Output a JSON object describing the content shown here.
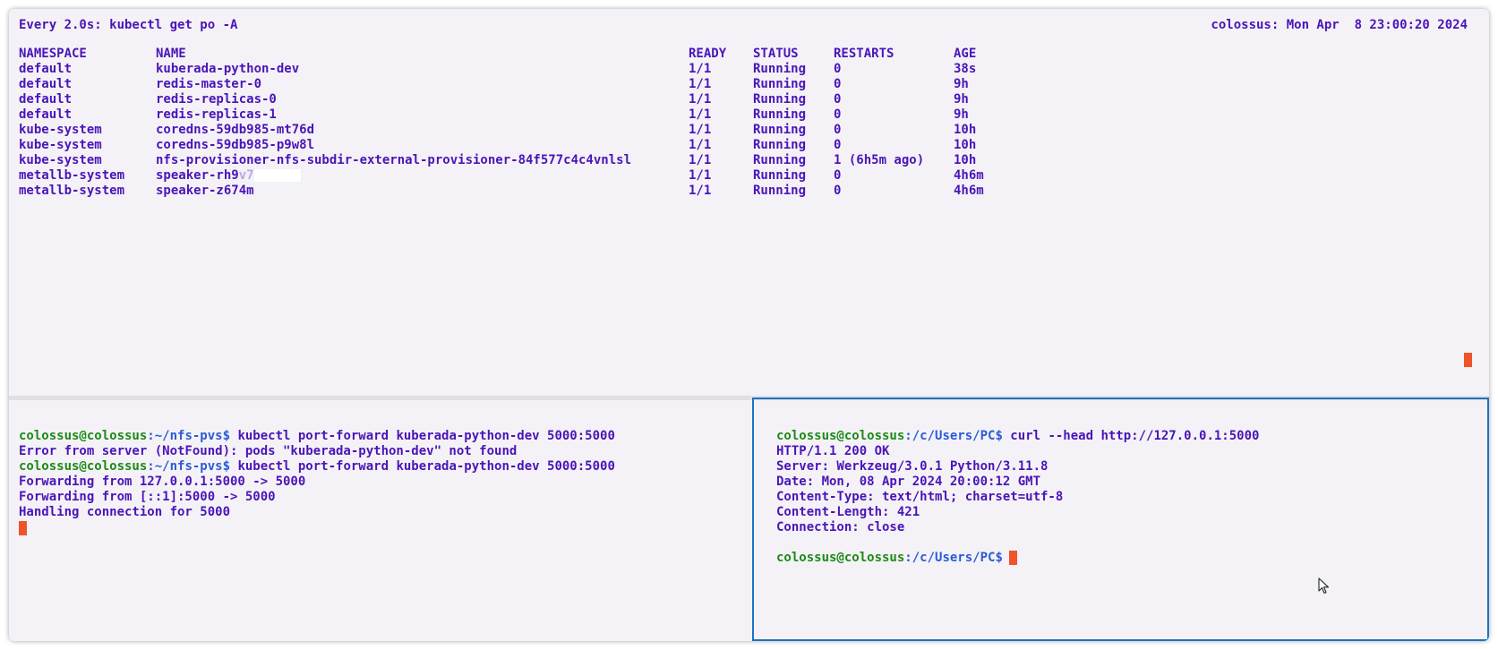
{
  "top_pane": {
    "header_left": "Every 2.0s: kubectl get po -A",
    "header_right": "colossus: Mon Apr  8 23:00:20 2024",
    "columns": [
      "NAMESPACE",
      "NAME",
      "READY",
      "STATUS",
      "RESTARTS",
      "AGE"
    ],
    "rows": [
      {
        "namespace": "default",
        "name": "kuberada-python-dev",
        "ready": "1/1",
        "status": "Running",
        "restarts": "0",
        "age": "38s"
      },
      {
        "namespace": "default",
        "name": "redis-master-0",
        "ready": "1/1",
        "status": "Running",
        "restarts": "0",
        "age": "9h"
      },
      {
        "namespace": "default",
        "name": "redis-replicas-0",
        "ready": "1/1",
        "status": "Running",
        "restarts": "0",
        "age": "9h"
      },
      {
        "namespace": "default",
        "name": "redis-replicas-1",
        "ready": "1/1",
        "status": "Running",
        "restarts": "0",
        "age": "9h"
      },
      {
        "namespace": "kube-system",
        "name": "coredns-59db985-mt76d",
        "ready": "1/1",
        "status": "Running",
        "restarts": "0",
        "age": "10h"
      },
      {
        "namespace": "kube-system",
        "name": "coredns-59db985-p9w8l",
        "ready": "1/1",
        "status": "Running",
        "restarts": "0",
        "age": "10h"
      },
      {
        "namespace": "kube-system",
        "name": "nfs-provisioner-nfs-subdir-external-provisioner-84f577c4c4vnlsl",
        "ready": "1/1",
        "status": "Running",
        "restarts": "1 (6h5m ago)",
        "age": "10h"
      },
      {
        "namespace": "metallb-system",
        "name": "speaker-rh9",
        "name_faded": "v7",
        "ready": "1/1",
        "status": "Running",
        "restarts": "0",
        "age": "4h6m"
      },
      {
        "namespace": "metallb-system",
        "name": "speaker-z674m",
        "ready": "1/1",
        "status": "Running",
        "restarts": "0",
        "age": "4h6m"
      }
    ]
  },
  "bottom_left_pane": {
    "prompt_user": "colossus@colossus",
    "prompt_path": ":~/nfs-pvs$",
    "cmd1": " kubectl port-forward kuberada-python-dev 5000:5000",
    "error": "Error from server (NotFound): pods \"kuberada-python-dev\" not found",
    "cmd2": " kubectl port-forward kuberada-python-dev 5000:5000",
    "out1": "Forwarding from 127.0.0.1:5000 -> 5000",
    "out2": "Forwarding from [::1]:5000 -> 5000",
    "out3": "Handling connection for 5000"
  },
  "bottom_right_pane": {
    "prompt_user": "colossus@colossus",
    "prompt_path": ":/c/Users/PC$",
    "cmd": " curl --head http://127.0.0.1:5000",
    "response": [
      "HTTP/1.1 200 OK",
      "Server: Werkzeug/3.0.1 Python/3.11.8",
      "Date: Mon, 08 Apr 2024 20:00:12 GMT",
      "Content-Type: text/html; charset=utf-8",
      "Content-Length: 421",
      "Connection: close"
    ]
  },
  "colors": {
    "text": "#4a15b8",
    "prompt_user": "#1c8a16",
    "prompt_path": "#2b5bd8",
    "cursor": "#f0522a",
    "active_pane_border": "#1a73c2",
    "background": "#f4f2f6"
  }
}
